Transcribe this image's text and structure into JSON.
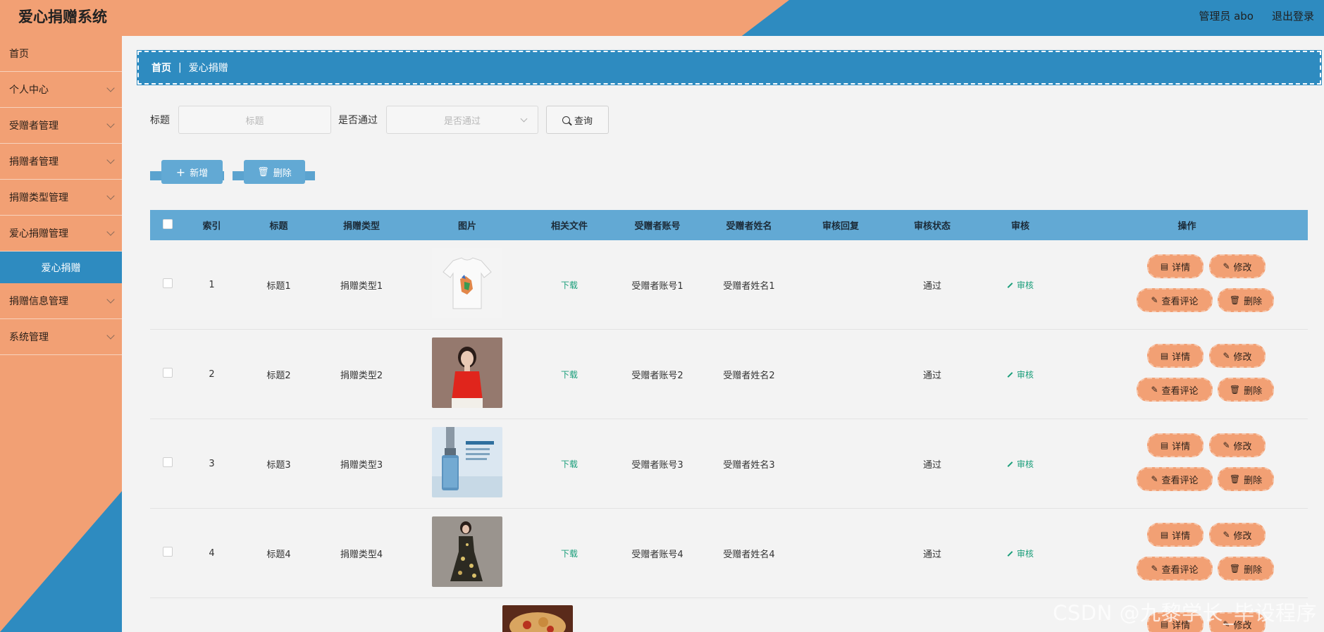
{
  "header": {
    "app_title": "爱心捐赠系统",
    "user_label": "管理员 abo",
    "logout_label": "退出登录"
  },
  "sidebar": {
    "items": [
      {
        "label": "首页",
        "has_chevron": false
      },
      {
        "label": "个人中心",
        "has_chevron": true
      },
      {
        "label": "受赠者管理",
        "has_chevron": true
      },
      {
        "label": "捐赠者管理",
        "has_chevron": true
      },
      {
        "label": "捐赠类型管理",
        "has_chevron": true
      },
      {
        "label": "爱心捐赠管理",
        "has_chevron": true
      },
      {
        "label": "爱心捐赠",
        "sub": true
      },
      {
        "label": "捐赠信息管理",
        "has_chevron": true
      },
      {
        "label": "系统管理",
        "has_chevron": true
      }
    ]
  },
  "breadcrumb": {
    "home": "首页",
    "separator": "|",
    "current": "爱心捐赠"
  },
  "filter": {
    "title_label": "标题",
    "title_placeholder": "标题",
    "passed_label": "是否通过",
    "passed_placeholder": "是否通过",
    "query_label": "查询"
  },
  "actions": {
    "add_label": "新增",
    "delete_label": "删除"
  },
  "table": {
    "headers": [
      "索引",
      "标题",
      "捐赠类型",
      "图片",
      "相关文件",
      "受赠者账号",
      "受赠者姓名",
      "审核回复",
      "审核状态",
      "审核",
      "操作"
    ],
    "rows": [
      {
        "index": "1",
        "title": "标题1",
        "type": "捐赠类型1",
        "image": "white-tshirt",
        "file": "下载",
        "account": "受赠者账号1",
        "name": "受赠者姓名1",
        "reply": "",
        "status": "通过",
        "audit": "审核"
      },
      {
        "index": "2",
        "title": "标题2",
        "type": "捐赠类型2",
        "image": "red-top-woman",
        "file": "下载",
        "account": "受赠者账号2",
        "name": "受赠者姓名2",
        "reply": "",
        "status": "通过",
        "audit": "审核"
      },
      {
        "index": "3",
        "title": "标题3",
        "type": "捐赠类型3",
        "image": "serum-bottle",
        "file": "下载",
        "account": "受赠者账号3",
        "name": "受赠者姓名3",
        "reply": "",
        "status": "通过",
        "audit": "审核"
      },
      {
        "index": "4",
        "title": "标题4",
        "type": "捐赠类型4",
        "image": "floral-dress",
        "file": "下载",
        "account": "受赠者账号4",
        "name": "受赠者姓名4",
        "reply": "",
        "status": "通过",
        "audit": "审核"
      }
    ],
    "partial_row": {
      "image": "food-bowl"
    },
    "row_buttons": {
      "detail": "详情",
      "edit": "修改",
      "comments": "查看评论",
      "delete": "删除"
    }
  },
  "watermark": "CSDN @九黎学长_毕设程序",
  "colors": {
    "primary_blue": "#2e8bc0",
    "accent_orange": "#f2a074",
    "table_header": "#62a9d4",
    "link_green": "#1a9e7a"
  }
}
